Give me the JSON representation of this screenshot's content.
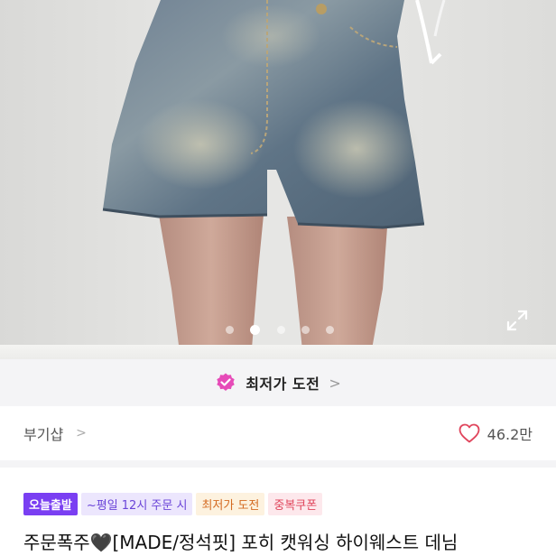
{
  "gallery": {
    "image_alt": "denim shorts product photo",
    "slide_count": 5,
    "active_index": 1,
    "expand_icon": "expand-icon"
  },
  "price_challenge": {
    "label": "최저가 도전",
    "icon": "badge-check-icon",
    "chevron": ">"
  },
  "shop": {
    "name": "부기샵",
    "chevron": ">",
    "likes": "46.2만",
    "like_icon": "heart-outline-icon",
    "heart_color": "#e0455c"
  },
  "badges": {
    "today": "오늘출발",
    "deadline": "~평일 12시 주문 시",
    "lowest": "최저가 도전",
    "coupon": "중복쿠폰"
  },
  "product": {
    "title": "주문폭주🖤[MADE/정석핏] 포히 캣워싱 하이웨스트 데님"
  },
  "colors": {
    "accent": "#7a3ff2",
    "challenge_badge": "#e64bb8"
  }
}
